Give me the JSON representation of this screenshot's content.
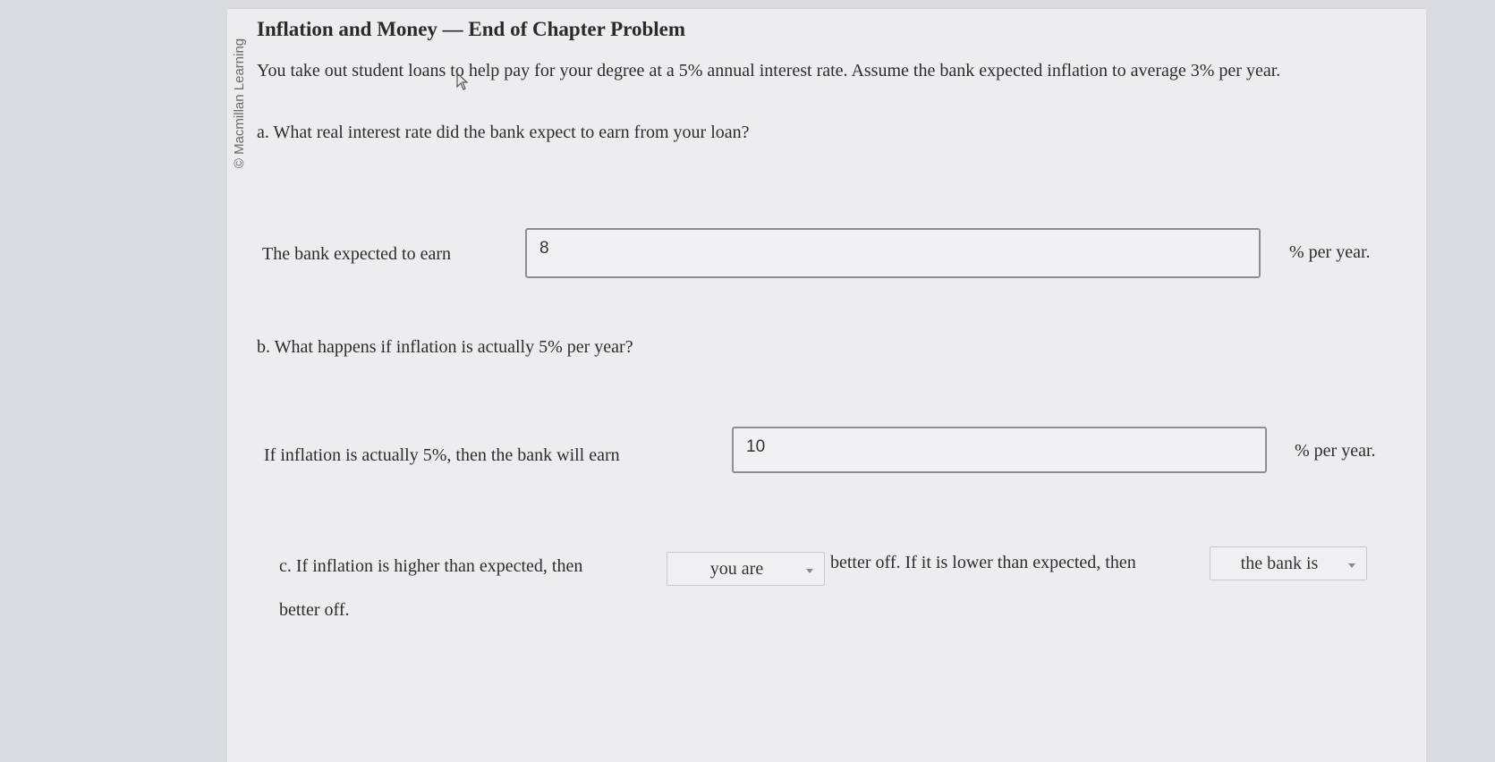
{
  "watermark": "© Macmillan Learning",
  "title": "Inflation and Money — End of Chapter Problem",
  "intro": "You take out student loans to help pay for your degree at a 5% annual interest rate. Assume the bank expected inflation to average 3% per year.",
  "part_a": {
    "question": "a. What real interest rate did the bank expect to earn from your loan?",
    "label": "The bank expected to earn",
    "value": "8",
    "unit": "% per year."
  },
  "part_b": {
    "question": "b. What happens if inflation is actually 5% per year?",
    "label": "If inflation is actually 5%, then the bank will earn",
    "value": "10",
    "unit": "% per year."
  },
  "part_c": {
    "text_1": "c. If inflation is higher than expected, then",
    "dropdown_1": "you are",
    "text_2": "better off. If it is lower than expected, then",
    "dropdown_2": "the bank is",
    "text_3": "better off."
  }
}
